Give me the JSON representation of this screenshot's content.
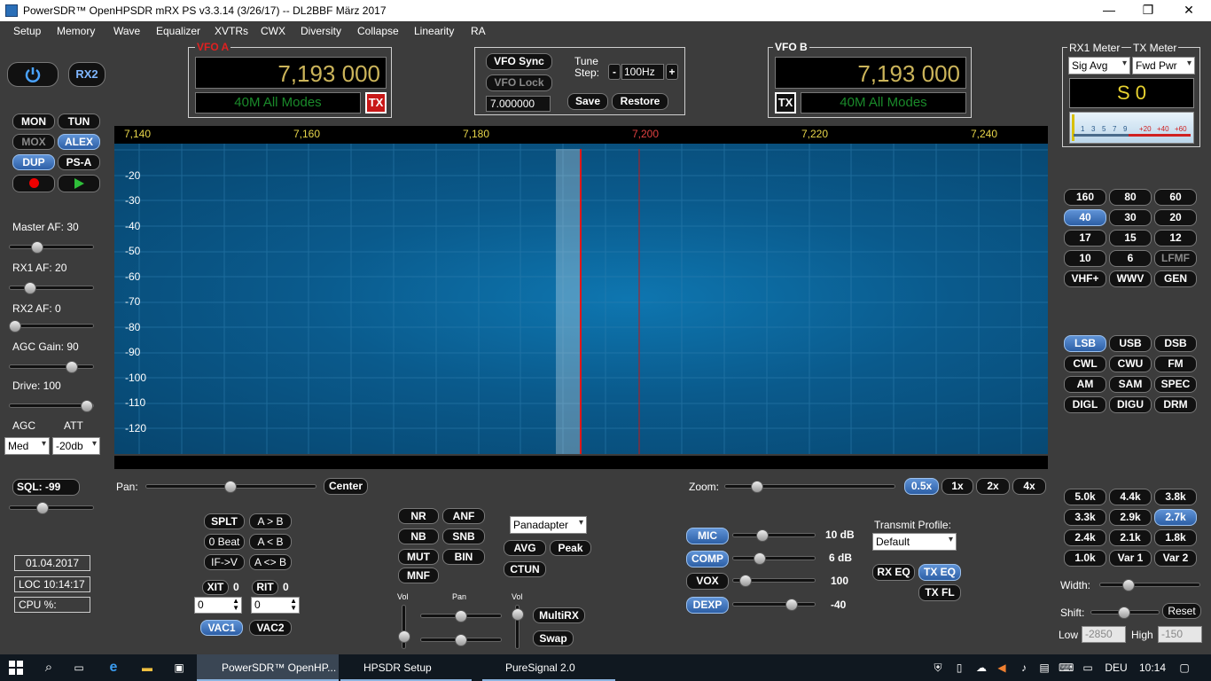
{
  "window": {
    "title": "PowerSDR™ OpenHPSDR mRX PS v3.3.14 (3/26/17)   --   DL2BBF März 2017",
    "minimize": "—",
    "maximize": "❐",
    "close": "✕"
  },
  "menu": [
    "Setup",
    "Memory",
    "Wave",
    "Equalizer",
    "XVTRs",
    "CWX",
    "Diversity",
    "Collapse",
    "Linearity",
    "RA"
  ],
  "power": {
    "rx2": "RX2"
  },
  "left_buttons": {
    "mon": "MON",
    "tun": "TUN",
    "mox": "MOX",
    "alex": "ALEX",
    "dup": "DUP",
    "psa": "PS-A"
  },
  "audio": {
    "master_af_label": "Master AF:  30",
    "rx1_af_label": "RX1 AF:  20",
    "rx2_af_label": "RX2 AF:  0",
    "agc_gain_label": "AGC Gain:  90",
    "drive_label": "Drive:  100",
    "agc_label": "AGC",
    "att_label": "ATT",
    "agc_value": "Med",
    "att_value": "-20db",
    "sql_label": "SQL:  -99"
  },
  "status": {
    "date": "01.04.2017",
    "loc": "LOC 10:14:17",
    "cpu": "CPU %:"
  },
  "vfo_a": {
    "title": "VFO A",
    "freq": "7,193 000",
    "band": "40M All Modes",
    "tx": "TX"
  },
  "vfo_b": {
    "title": "VFO B",
    "freq": "7,193 000",
    "band": "40M All Modes",
    "tx": "TX"
  },
  "vfo_center": {
    "sync": "VFO Sync",
    "lock": "VFO Lock",
    "freq_field": "7.000000",
    "tune_label": "Tune",
    "step_label": "Step:",
    "minus": "-",
    "plus": "+",
    "step": "100Hz",
    "save": "Save",
    "restore": "Restore"
  },
  "meters": {
    "rx1": "RX1 Meter",
    "tx": "TX Meter",
    "rx1_sel": "Sig Avg",
    "tx_sel": "Fwd Pwr",
    "reading": "S 0",
    "scale": [
      "1",
      "3",
      "5",
      "7",
      "9",
      "+20",
      "+40",
      "+60"
    ]
  },
  "spectrum": {
    "freq_labels": [
      "7,140",
      "7,160",
      "7,180",
      "7,200",
      "7,220",
      "7,240"
    ],
    "db_labels": [
      "-20",
      "-30",
      "-40",
      "-50",
      "-60",
      "-70",
      "-80",
      "-90",
      "-100",
      "-110",
      "-120"
    ],
    "pan_label": "Pan:",
    "center": "Center",
    "zoom_label": "Zoom:",
    "zoom": [
      "0.5x",
      "1x",
      "2x",
      "4x"
    ]
  },
  "bands": [
    "160",
    "80",
    "60",
    "40",
    "30",
    "20",
    "17",
    "15",
    "12",
    "10",
    "6",
    "LFMF",
    "VHF+",
    "WWV",
    "GEN"
  ],
  "modes": [
    "LSB",
    "USB",
    "DSB",
    "CWL",
    "CWU",
    "FM",
    "AM",
    "SAM",
    "SPEC",
    "DIGL",
    "DIGU",
    "DRM"
  ],
  "filters": [
    "5.0k",
    "4.4k",
    "3.8k",
    "3.3k",
    "2.9k",
    "2.7k",
    "2.4k",
    "2.1k",
    "1.8k",
    "1.0k",
    "Var 1",
    "Var 2"
  ],
  "filter_ctrl": {
    "width": "Width:",
    "shift": "Shift:",
    "reset": "Reset",
    "low": "Low",
    "high": "High",
    "low_val": "-2850",
    "high_val": "-150"
  },
  "split": {
    "splt": "SPLT",
    "a_b": "A > B",
    "zero_beat": "0 Beat",
    "a_lt_b": "A < B",
    "if_v": "IF->V",
    "a_swap": "A <> B",
    "xit": "XIT",
    "rit": "RIT",
    "xit_val": "0",
    "rit_val": "0",
    "xit_field": "0",
    "rit_field": "0",
    "vac1": "VAC1",
    "vac2": "VAC2"
  },
  "dsp": {
    "nr": "NR",
    "anf": "ANF",
    "nb": "NB",
    "snb": "SNB",
    "mut": "MUT",
    "bin": "BIN",
    "mnf": "MNF",
    "display_mode": "Panadapter",
    "avg": "AVG",
    "peak": "Peak",
    "ctun": "CTUN",
    "vol": "Vol",
    "pan": "Pan",
    "vol2": "Vol",
    "multirx": "MultiRX",
    "swap": "Swap"
  },
  "tx_proc": {
    "mic": "MIC",
    "mic_val": "10 dB",
    "comp": "COMP",
    "comp_val": "6 dB",
    "vox": "VOX",
    "vox_val": "100",
    "dexp": "DEXP",
    "dexp_val": "-40",
    "profile_label": "Transmit Profile:",
    "profile": "Default",
    "rx_eq": "RX EQ",
    "tx_eq": "TX EQ",
    "tx_fl": "TX FL"
  },
  "taskbar": {
    "app1": "PowerSDR™ OpenHP...",
    "app2": "HPSDR Setup",
    "app3": "PureSignal 2.0",
    "lang": "DEU",
    "time": "10:14"
  }
}
